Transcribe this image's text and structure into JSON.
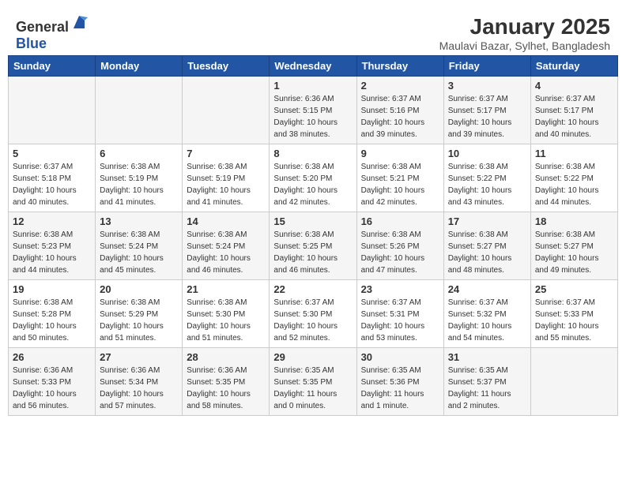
{
  "logo": {
    "text_general": "General",
    "text_blue": "Blue"
  },
  "calendar": {
    "title": "January 2025",
    "subtitle": "Maulavi Bazar, Sylhet, Bangladesh"
  },
  "days_of_week": [
    "Sunday",
    "Monday",
    "Tuesday",
    "Wednesday",
    "Thursday",
    "Friday",
    "Saturday"
  ],
  "weeks": [
    {
      "days": [
        {
          "num": "",
          "sunrise": "",
          "sunset": "",
          "daylight": ""
        },
        {
          "num": "",
          "sunrise": "",
          "sunset": "",
          "daylight": ""
        },
        {
          "num": "",
          "sunrise": "",
          "sunset": "",
          "daylight": ""
        },
        {
          "num": "1",
          "sunrise": "Sunrise: 6:36 AM",
          "sunset": "Sunset: 5:15 PM",
          "daylight": "Daylight: 10 hours and 38 minutes."
        },
        {
          "num": "2",
          "sunrise": "Sunrise: 6:37 AM",
          "sunset": "Sunset: 5:16 PM",
          "daylight": "Daylight: 10 hours and 39 minutes."
        },
        {
          "num": "3",
          "sunrise": "Sunrise: 6:37 AM",
          "sunset": "Sunset: 5:17 PM",
          "daylight": "Daylight: 10 hours and 39 minutes."
        },
        {
          "num": "4",
          "sunrise": "Sunrise: 6:37 AM",
          "sunset": "Sunset: 5:17 PM",
          "daylight": "Daylight: 10 hours and 40 minutes."
        }
      ]
    },
    {
      "days": [
        {
          "num": "5",
          "sunrise": "Sunrise: 6:37 AM",
          "sunset": "Sunset: 5:18 PM",
          "daylight": "Daylight: 10 hours and 40 minutes."
        },
        {
          "num": "6",
          "sunrise": "Sunrise: 6:38 AM",
          "sunset": "Sunset: 5:19 PM",
          "daylight": "Daylight: 10 hours and 41 minutes."
        },
        {
          "num": "7",
          "sunrise": "Sunrise: 6:38 AM",
          "sunset": "Sunset: 5:19 PM",
          "daylight": "Daylight: 10 hours and 41 minutes."
        },
        {
          "num": "8",
          "sunrise": "Sunrise: 6:38 AM",
          "sunset": "Sunset: 5:20 PM",
          "daylight": "Daylight: 10 hours and 42 minutes."
        },
        {
          "num": "9",
          "sunrise": "Sunrise: 6:38 AM",
          "sunset": "Sunset: 5:21 PM",
          "daylight": "Daylight: 10 hours and 42 minutes."
        },
        {
          "num": "10",
          "sunrise": "Sunrise: 6:38 AM",
          "sunset": "Sunset: 5:22 PM",
          "daylight": "Daylight: 10 hours and 43 minutes."
        },
        {
          "num": "11",
          "sunrise": "Sunrise: 6:38 AM",
          "sunset": "Sunset: 5:22 PM",
          "daylight": "Daylight: 10 hours and 44 minutes."
        }
      ]
    },
    {
      "days": [
        {
          "num": "12",
          "sunrise": "Sunrise: 6:38 AM",
          "sunset": "Sunset: 5:23 PM",
          "daylight": "Daylight: 10 hours and 44 minutes."
        },
        {
          "num": "13",
          "sunrise": "Sunrise: 6:38 AM",
          "sunset": "Sunset: 5:24 PM",
          "daylight": "Daylight: 10 hours and 45 minutes."
        },
        {
          "num": "14",
          "sunrise": "Sunrise: 6:38 AM",
          "sunset": "Sunset: 5:24 PM",
          "daylight": "Daylight: 10 hours and 46 minutes."
        },
        {
          "num": "15",
          "sunrise": "Sunrise: 6:38 AM",
          "sunset": "Sunset: 5:25 PM",
          "daylight": "Daylight: 10 hours and 46 minutes."
        },
        {
          "num": "16",
          "sunrise": "Sunrise: 6:38 AM",
          "sunset": "Sunset: 5:26 PM",
          "daylight": "Daylight: 10 hours and 47 minutes."
        },
        {
          "num": "17",
          "sunrise": "Sunrise: 6:38 AM",
          "sunset": "Sunset: 5:27 PM",
          "daylight": "Daylight: 10 hours and 48 minutes."
        },
        {
          "num": "18",
          "sunrise": "Sunrise: 6:38 AM",
          "sunset": "Sunset: 5:27 PM",
          "daylight": "Daylight: 10 hours and 49 minutes."
        }
      ]
    },
    {
      "days": [
        {
          "num": "19",
          "sunrise": "Sunrise: 6:38 AM",
          "sunset": "Sunset: 5:28 PM",
          "daylight": "Daylight: 10 hours and 50 minutes."
        },
        {
          "num": "20",
          "sunrise": "Sunrise: 6:38 AM",
          "sunset": "Sunset: 5:29 PM",
          "daylight": "Daylight: 10 hours and 51 minutes."
        },
        {
          "num": "21",
          "sunrise": "Sunrise: 6:38 AM",
          "sunset": "Sunset: 5:30 PM",
          "daylight": "Daylight: 10 hours and 51 minutes."
        },
        {
          "num": "22",
          "sunrise": "Sunrise: 6:37 AM",
          "sunset": "Sunset: 5:30 PM",
          "daylight": "Daylight: 10 hours and 52 minutes."
        },
        {
          "num": "23",
          "sunrise": "Sunrise: 6:37 AM",
          "sunset": "Sunset: 5:31 PM",
          "daylight": "Daylight: 10 hours and 53 minutes."
        },
        {
          "num": "24",
          "sunrise": "Sunrise: 6:37 AM",
          "sunset": "Sunset: 5:32 PM",
          "daylight": "Daylight: 10 hours and 54 minutes."
        },
        {
          "num": "25",
          "sunrise": "Sunrise: 6:37 AM",
          "sunset": "Sunset: 5:33 PM",
          "daylight": "Daylight: 10 hours and 55 minutes."
        }
      ]
    },
    {
      "days": [
        {
          "num": "26",
          "sunrise": "Sunrise: 6:36 AM",
          "sunset": "Sunset: 5:33 PM",
          "daylight": "Daylight: 10 hours and 56 minutes."
        },
        {
          "num": "27",
          "sunrise": "Sunrise: 6:36 AM",
          "sunset": "Sunset: 5:34 PM",
          "daylight": "Daylight: 10 hours and 57 minutes."
        },
        {
          "num": "28",
          "sunrise": "Sunrise: 6:36 AM",
          "sunset": "Sunset: 5:35 PM",
          "daylight": "Daylight: 10 hours and 58 minutes."
        },
        {
          "num": "29",
          "sunrise": "Sunrise: 6:35 AM",
          "sunset": "Sunset: 5:35 PM",
          "daylight": "Daylight: 11 hours and 0 minutes."
        },
        {
          "num": "30",
          "sunrise": "Sunrise: 6:35 AM",
          "sunset": "Sunset: 5:36 PM",
          "daylight": "Daylight: 11 hours and 1 minute."
        },
        {
          "num": "31",
          "sunrise": "Sunrise: 6:35 AM",
          "sunset": "Sunset: 5:37 PM",
          "daylight": "Daylight: 11 hours and 2 minutes."
        },
        {
          "num": "",
          "sunrise": "",
          "sunset": "",
          "daylight": ""
        }
      ]
    }
  ]
}
